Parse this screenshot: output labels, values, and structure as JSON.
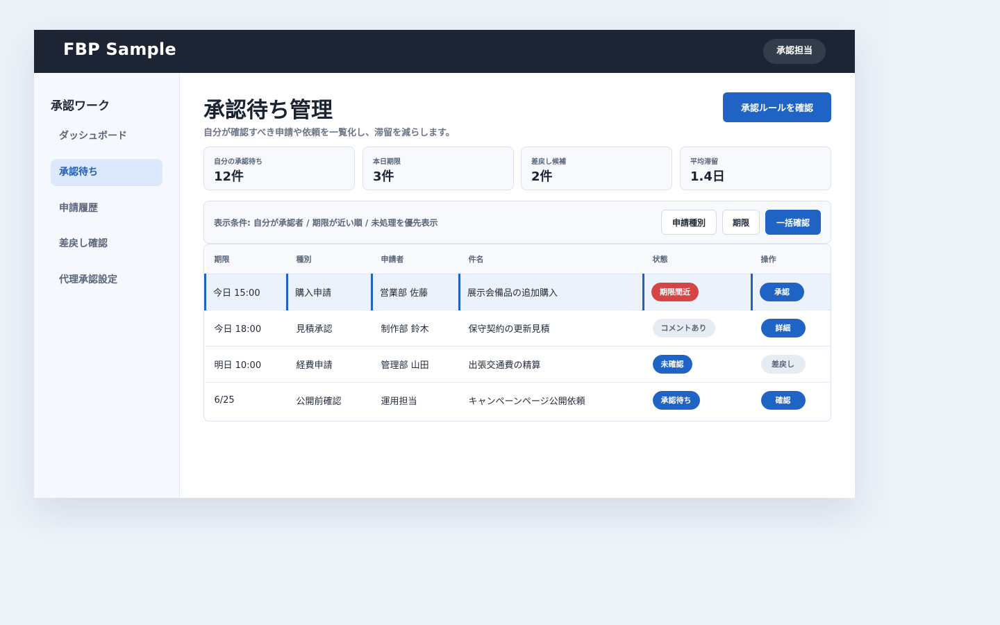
{
  "header": {
    "brand": "FBP Sample",
    "role": "承認担当"
  },
  "sidebar": {
    "title": "承認ワーク",
    "items": [
      {
        "label": "ダッシュボード",
        "active": false
      },
      {
        "label": "承認待ち",
        "active": true
      },
      {
        "label": "申請履歴",
        "active": false
      },
      {
        "label": "差戻し確認",
        "active": false
      },
      {
        "label": "代理承認設定",
        "active": false
      }
    ]
  },
  "main": {
    "title": "承認待ち管理",
    "subtitle": "自分が確認すべき申請や依頼を一覧化し、滞留を減らします。",
    "rules_button": "承認ルールを確認",
    "stats": [
      {
        "label": "自分の承認待ち",
        "value": "12件"
      },
      {
        "label": "本日期限",
        "value": "3件"
      },
      {
        "label": "差戻し候補",
        "value": "2件"
      },
      {
        "label": "平均滞留",
        "value": "1.4日"
      }
    ],
    "filter": {
      "text": "表示条件: 自分が承認者 / 期限が近い順 / 未処理を優先表示",
      "type_button": "申請種別",
      "due_button": "期限",
      "bulk_button": "一括確認"
    },
    "table": {
      "headers": [
        "期限",
        "種別",
        "申請者",
        "件名",
        "状態",
        "操作"
      ],
      "rows": [
        {
          "due": "今日 15:00",
          "type": "購入申請",
          "applicant": "営業部 佐藤",
          "subject": "展示会備品の追加購入",
          "status": "期限間近",
          "action": "承認"
        },
        {
          "due": "今日 18:00",
          "type": "見積承認",
          "applicant": "制作部 鈴木",
          "subject": "保守契約の更新見積",
          "status": "コメントあり",
          "action": "詳細"
        },
        {
          "due": "明日 10:00",
          "type": "経費申請",
          "applicant": "管理部 山田",
          "subject": "出張交通費の精算",
          "status": "未確認",
          "action": "差戻し"
        },
        {
          "due": "6/25",
          "type": "公開前確認",
          "applicant": "運用担当",
          "subject": "キャンペーンページ公開依頼",
          "status": "承認待ち",
          "action": "確認"
        }
      ]
    }
  },
  "colors": {
    "topbar": "#1d2534",
    "accent": "#1f64c4",
    "danger": "#d64545",
    "sidebar_active_bg": "#dce9fb"
  }
}
